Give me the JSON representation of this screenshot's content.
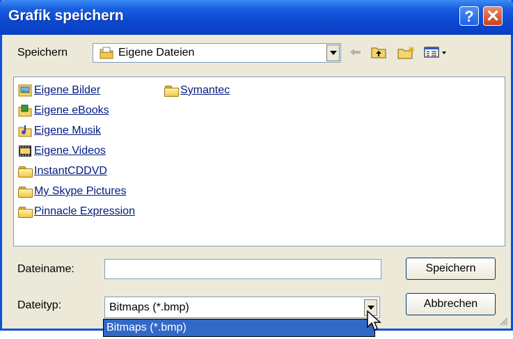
{
  "window": {
    "title": "Grafik speichern",
    "help_glyph": "?",
    "close_glyph": "✕"
  },
  "save_in": {
    "label": "Speichern",
    "value": "Eigene Dateien"
  },
  "toolbar": {
    "icons": [
      "back-arrow-icon",
      "up-folder-icon",
      "new-folder-icon",
      "view-menu-icon"
    ]
  },
  "files": [
    {
      "name": "Eigene Bilder",
      "icon": "pictures-folder-icon"
    },
    {
      "name": "Eigene eBooks",
      "icon": "ebooks-folder-icon"
    },
    {
      "name": "Eigene Musik",
      "icon": "music-folder-icon"
    },
    {
      "name": "Eigene Videos",
      "icon": "videos-folder-icon"
    },
    {
      "name": "InstantCDDVD",
      "icon": "folder-icon"
    },
    {
      "name": "My Skype Pictures",
      "icon": "folder-icon"
    },
    {
      "name": "Pinnacle Expression",
      "icon": "folder-icon"
    },
    {
      "name": "Symantec",
      "icon": "folder-icon"
    }
  ],
  "filename": {
    "label": "Dateiname:",
    "value": ""
  },
  "filetype": {
    "label": "Dateityp:",
    "value": "Bitmaps (*.bmp)",
    "options": [
      "Bitmaps (*.bmp)"
    ]
  },
  "buttons": {
    "save": "Speichern",
    "cancel": "Abbrechen"
  },
  "colors": {
    "titlebar": "#0a48d0",
    "selection": "#3169c6",
    "dialog_bg": "#ece9d8"
  }
}
